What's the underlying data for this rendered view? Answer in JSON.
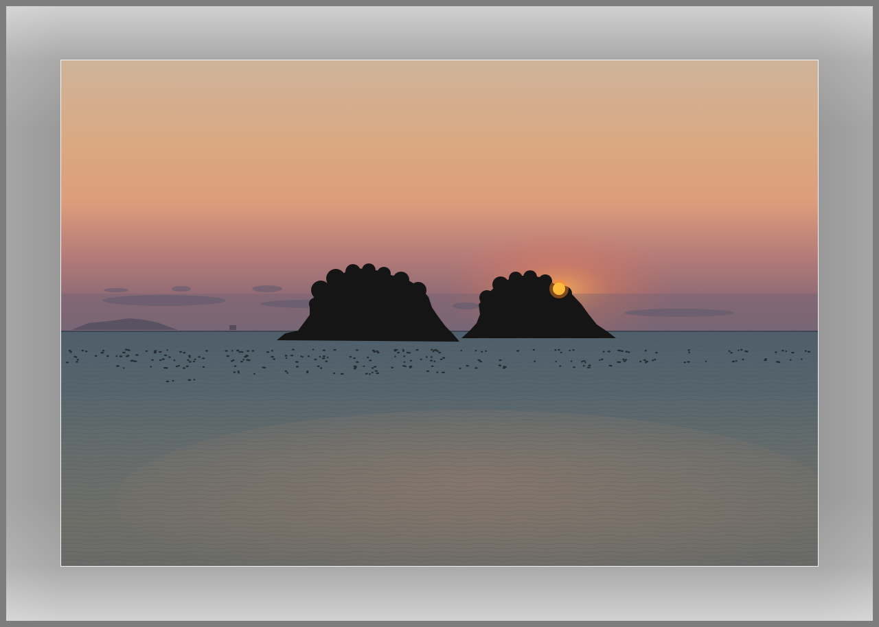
{
  "photo": {
    "subject": "",
    "colors": {
      "sky_top": "#d4b596",
      "sky_mid": "#dda47f",
      "sky_horizon": "#9b6d72",
      "haze": "#7a6276",
      "sea_far": "#5a6a74",
      "sea_near": "#6e716c",
      "sun": "#ffd23a",
      "silhouette": "#151515"
    }
  },
  "frame": {
    "mat_color": "#9a9a9a",
    "border_color": "#f2f2f2"
  }
}
